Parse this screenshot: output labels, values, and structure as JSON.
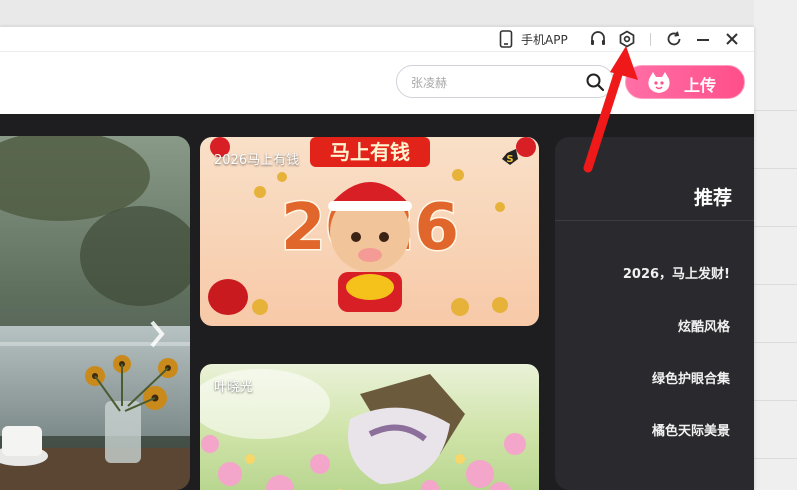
{
  "titlebar": {
    "mobile_app_label": "手机APP"
  },
  "search": {
    "placeholder": "张凌赫"
  },
  "upload_button": {
    "label": "上传"
  },
  "cards": [
    {
      "caption": "2026马上有钱",
      "banner_text": "马上有钱",
      "year_text": "2026",
      "badge": "S"
    },
    {
      "caption": "叶晓光"
    }
  ],
  "recommend": {
    "title": "推荐",
    "items": [
      "2026，马上发财!",
      "炫酷风格",
      "绿色护眼合集",
      "橘色天际美景"
    ]
  },
  "colors": {
    "accent": "#ff4f8a",
    "annotation_arrow": "#f01919",
    "panel_bg": "#2a2a2e",
    "content_bg": "#1e1e20"
  }
}
